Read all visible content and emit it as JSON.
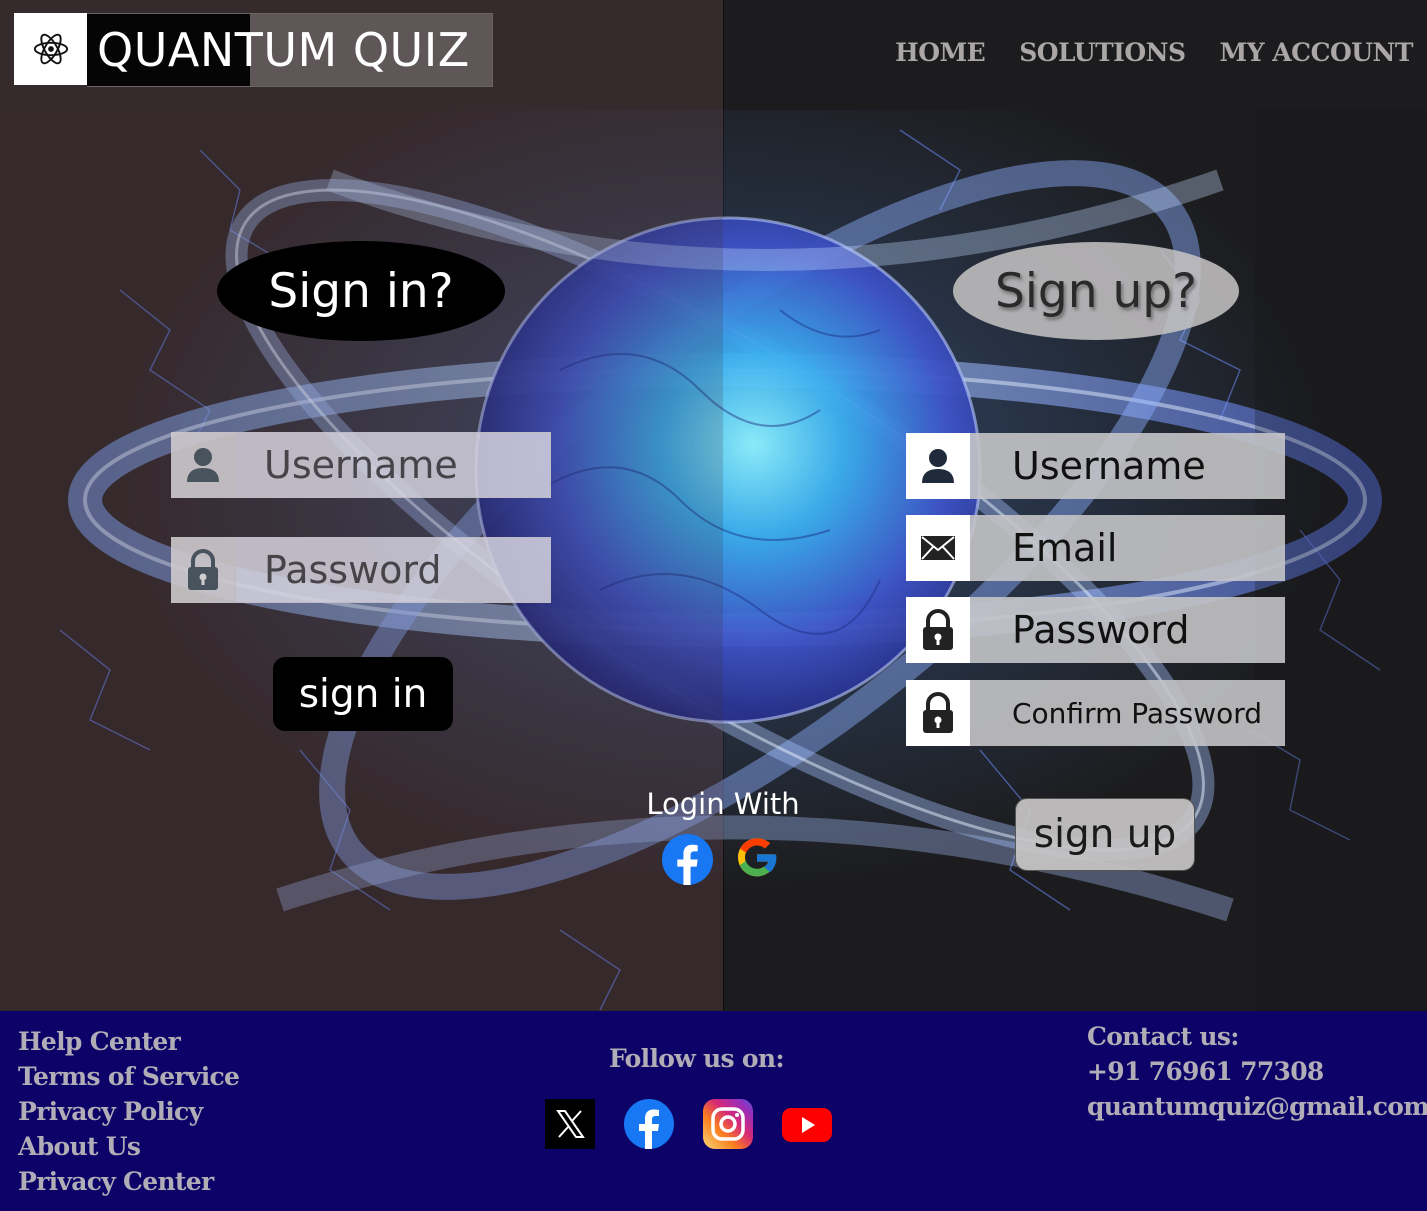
{
  "app": {
    "title": "QUANTUM QUIZ",
    "logo_icon": "atom-icon"
  },
  "nav": {
    "items": [
      "HOME",
      "SOLUTIONS",
      "MY ACCOUNT"
    ]
  },
  "signin": {
    "heading": "Sign in?",
    "username_placeholder": "Username",
    "password_placeholder": "Password",
    "button": "sign in"
  },
  "signup": {
    "heading": "Sign up?",
    "username_placeholder": "Username",
    "email_placeholder": "Email",
    "password_placeholder": "Password",
    "confirm_placeholder": "Confirm Password",
    "button": "sign up"
  },
  "social_login": {
    "label": "Login With",
    "providers": [
      "facebook-icon",
      "google-icon"
    ]
  },
  "footer": {
    "links": [
      "Help Center",
      "Terms of Service",
      "Privacy Policy",
      "About Us",
      "Privacy Center"
    ],
    "follow_label": "Follow us on:",
    "social": [
      "x-icon",
      "facebook-icon",
      "instagram-icon",
      "youtube-icon"
    ],
    "contact_heading": "Contact us:",
    "phone": "+91 76961 77308",
    "email": "quantumquiz@gmail.com"
  },
  "colors": {
    "footer_bg": "#0d0268",
    "left_bg": "#352a2c",
    "right_bg": "#1c1c1e",
    "accent_blue": "#3f63ff"
  }
}
